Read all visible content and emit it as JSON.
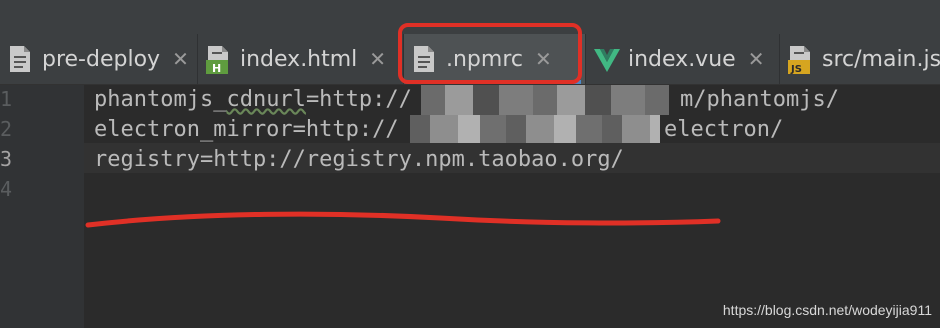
{
  "tabs": [
    {
      "label": "pre-deploy",
      "icon": "text-file-icon",
      "close": "✕",
      "active": false
    },
    {
      "label": "index.html",
      "icon": "html-file-icon",
      "icon_badge": "H",
      "close": "✕",
      "active": false
    },
    {
      "label": ".npmrc",
      "icon": "text-file-icon",
      "close": "✕",
      "active": true
    },
    {
      "label": "index.vue",
      "icon": "vue-file-icon",
      "close": "✕",
      "active": false
    },
    {
      "label": "src/main.js",
      "icon": "js-file-icon",
      "icon_badge": "JS",
      "active": false
    }
  ],
  "editor": {
    "line_numbers": [
      "1",
      "2",
      "3",
      "4"
    ],
    "current_line": 3,
    "lines": [
      {
        "before": "phantomjs_",
        "squiggle": "cdnurl",
        "after": "=http://",
        "tail": "m/phantomjs/"
      },
      {
        "text": "electron_mirror=http://",
        "tail": "electron/"
      },
      {
        "text": "registry=http://registry.npm.taobao.org/"
      },
      {
        "text": ""
      }
    ]
  },
  "watermark": "https://blog.csdn.net/wodeyijia911",
  "colors": {
    "background": "#2b2b2b",
    "tabbar": "#3c3f41",
    "active_tab": "#4e5254",
    "active_underline": "#4a88c7",
    "annotation_red": "#e03026",
    "text": "#bababa",
    "vue_green": "#41b883"
  }
}
